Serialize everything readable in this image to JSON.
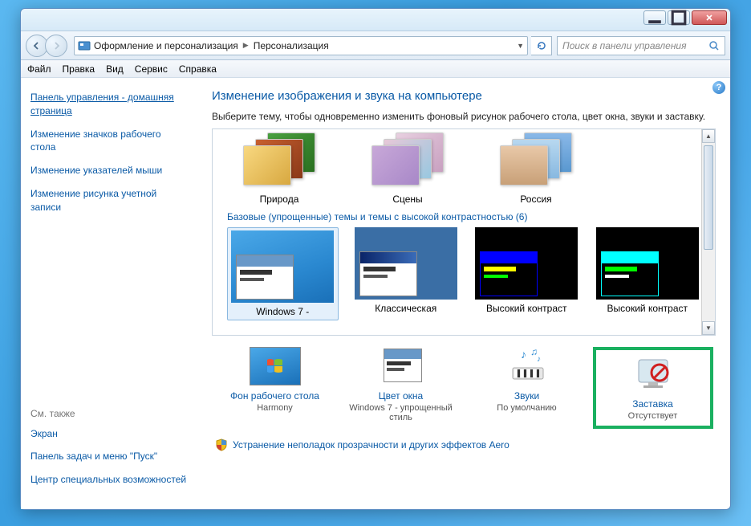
{
  "breadcrumb": {
    "part1": "Оформление и персонализация",
    "part2": "Персонализация"
  },
  "search": {
    "placeholder": "Поиск в панели управления"
  },
  "menu": {
    "file": "Файл",
    "edit": "Правка",
    "view": "Вид",
    "service": "Сервис",
    "help": "Справка"
  },
  "sidebar": {
    "home": "Панель управления - домашняя страница",
    "links": [
      "Изменение значков рабочего стола",
      "Изменение указателей мыши",
      "Изменение рисунка учетной записи"
    ],
    "see_also_heading": "См. также",
    "see_also": [
      "Экран",
      "Панель задач и меню \"Пуск\"",
      "Центр специальных возможностей"
    ]
  },
  "main": {
    "heading": "Изменение изображения и звука на компьютере",
    "subtitle": "Выберите тему, чтобы одновременно изменить фоновый рисунок рабочего стола, цвет окна, звуки и заставку.",
    "aero_themes": [
      {
        "name": "Природа"
      },
      {
        "name": "Сцены"
      },
      {
        "name": "Россия"
      }
    ],
    "basic_section": "Базовые (упрощенные) темы и темы с высокой контрастностью (6)",
    "basic_themes": [
      {
        "name": "Windows 7 - "
      },
      {
        "name": "Классическая"
      },
      {
        "name": "Высокий контраст"
      },
      {
        "name": "Высокий контраст"
      }
    ],
    "actions": {
      "background": {
        "label": "Фон рабочего стола",
        "value": "Harmony"
      },
      "color": {
        "label": "Цвет окна",
        "value": "Windows 7 - упрощенный стиль"
      },
      "sounds": {
        "label": "Звуки",
        "value": "По умолчанию"
      },
      "screensaver": {
        "label": "Заставка",
        "value": "Отсутствует"
      }
    },
    "troubleshoot": "Устранение неполадок прозрачности и других эффектов Aero"
  }
}
